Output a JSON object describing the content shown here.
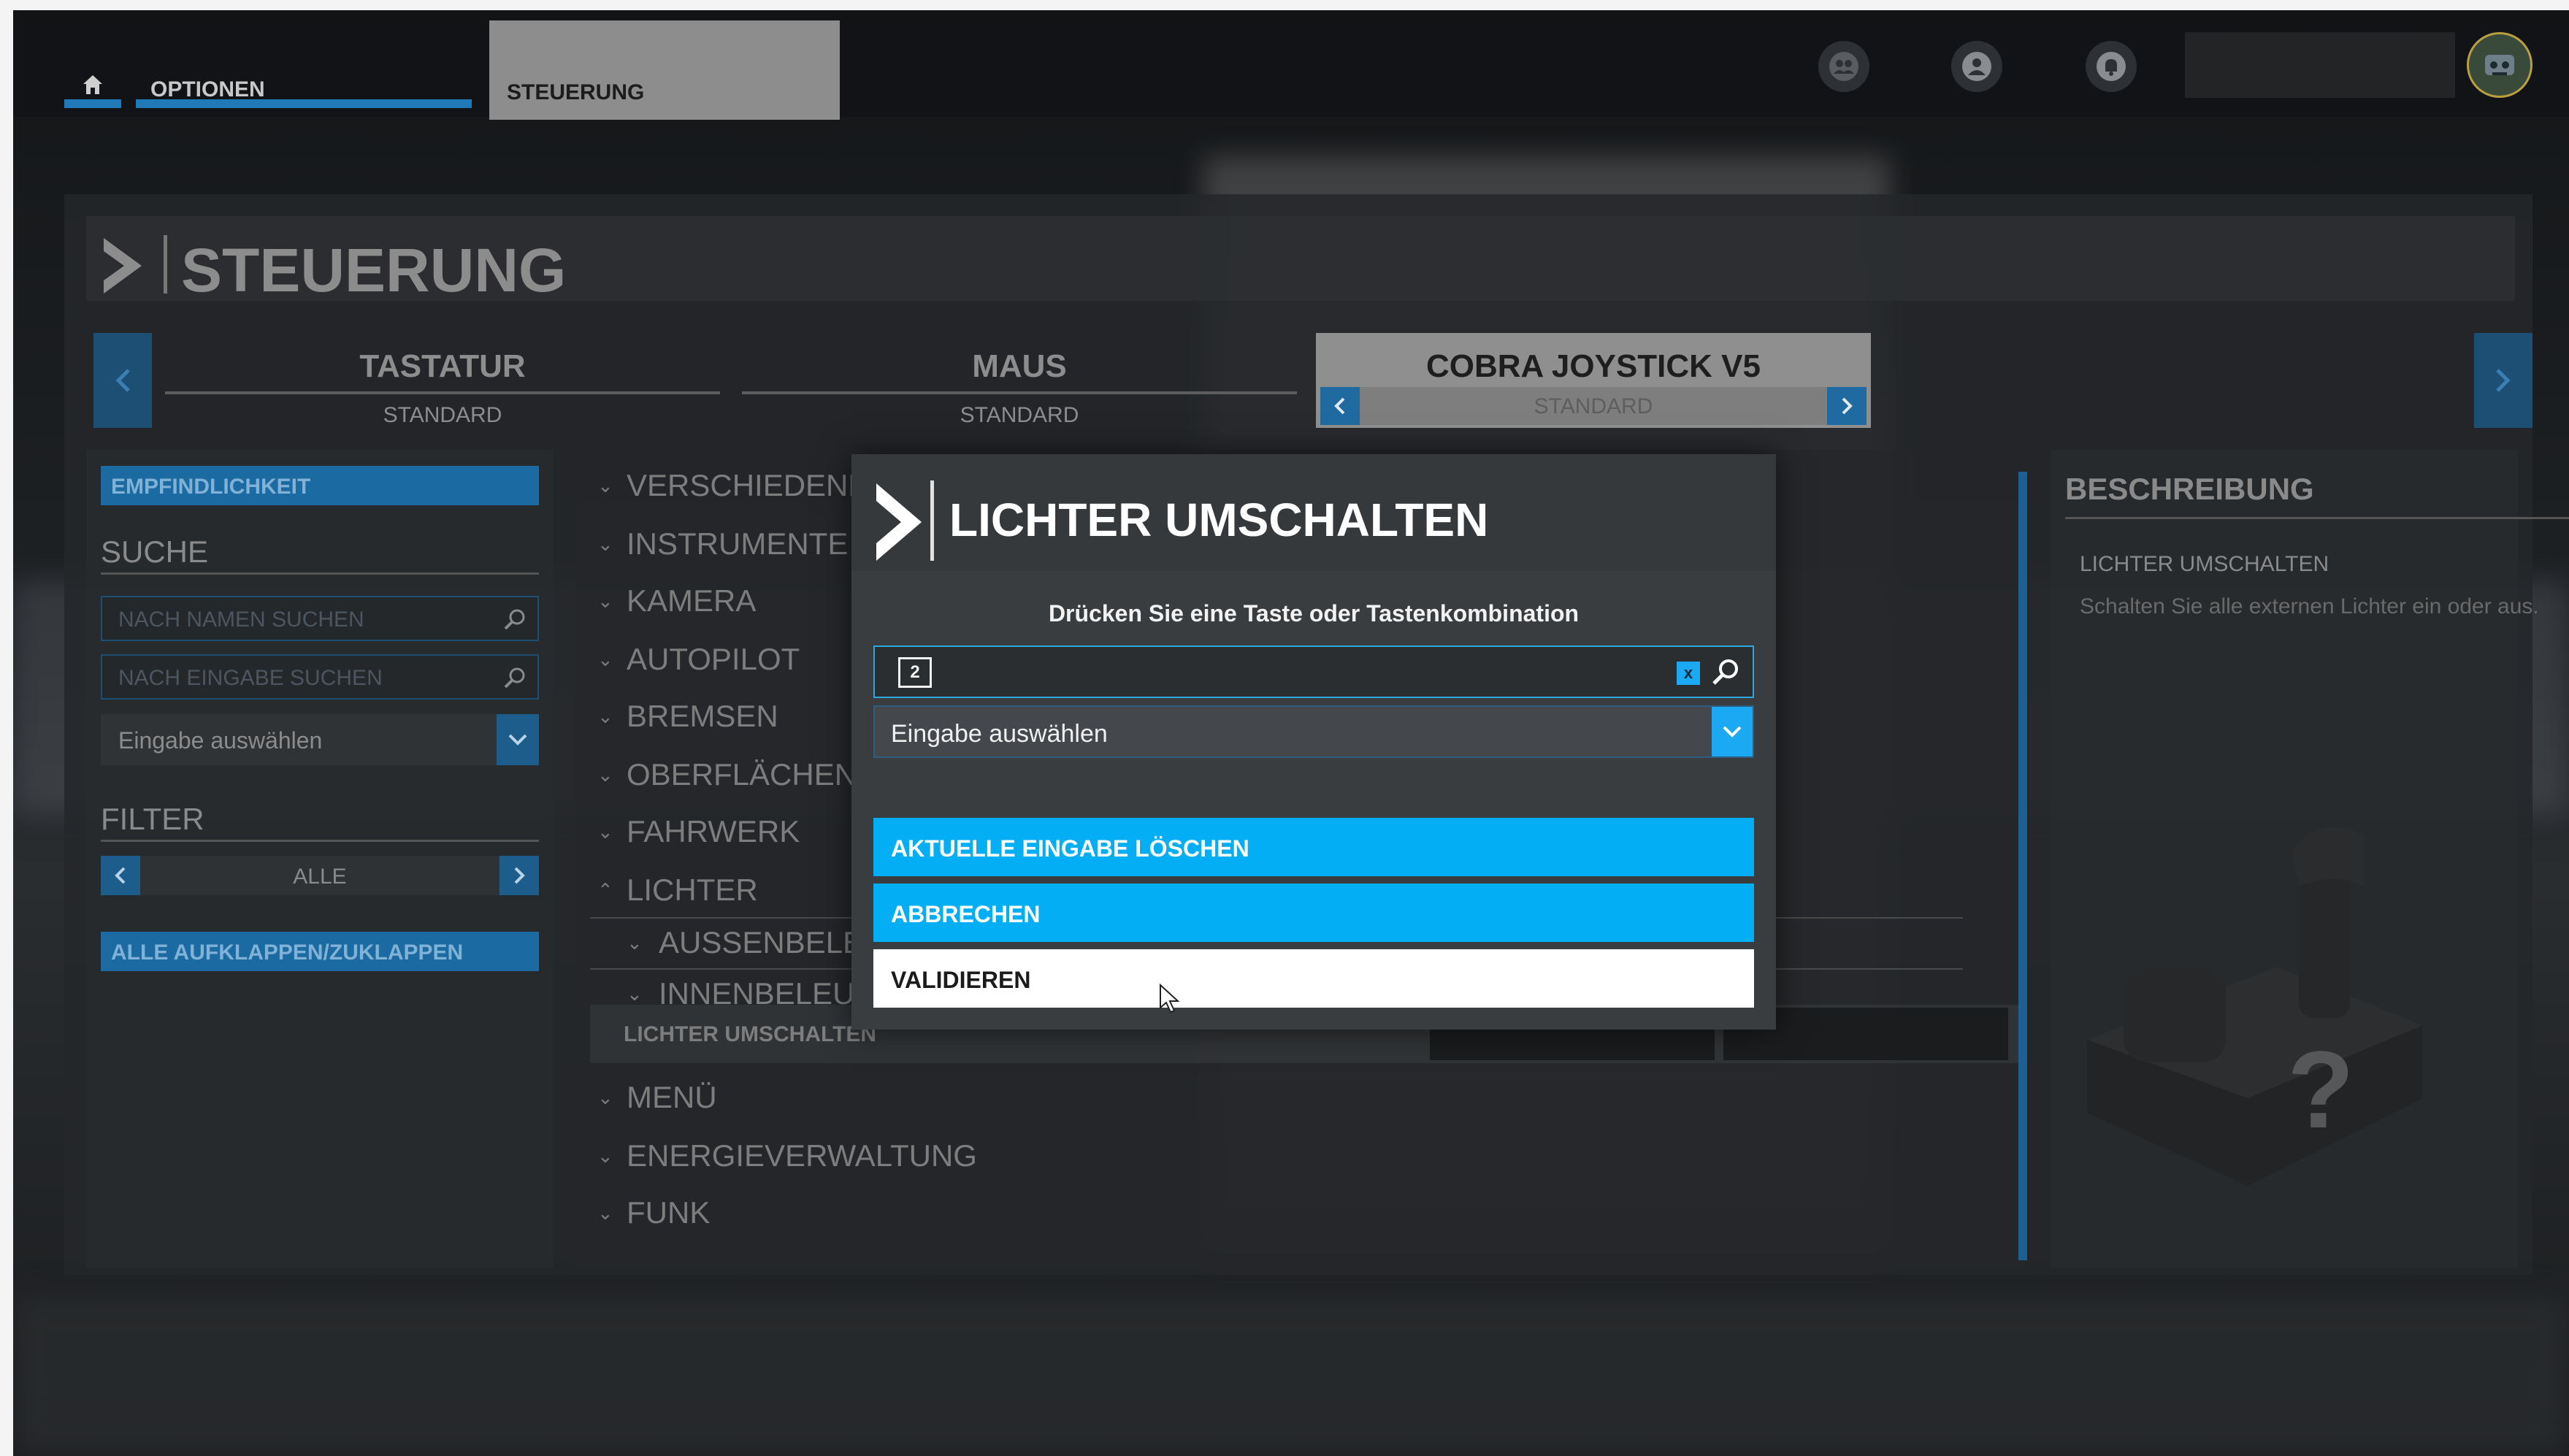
{
  "topbar": {
    "home_label": "",
    "options_tab": "OPTIONEN",
    "control_tab": "STEUERUNG",
    "icons": [
      "friends-icon",
      "profile-icon",
      "notifications-icon"
    ]
  },
  "page": {
    "title": "STEUERUNG"
  },
  "devices": [
    {
      "name": "TASTATUR",
      "profile": "STANDARD"
    },
    {
      "name": "MAUS",
      "profile": "STANDARD"
    },
    {
      "name": "COBRA JOYSTICK V5",
      "profile": "STANDARD"
    }
  ],
  "sidebar": {
    "sensitivity_button": "EMPFINDLICHKEIT",
    "search_heading": "SUCHE",
    "search_name_placeholder": "NACH NAMEN SUCHEN",
    "search_input_placeholder": "NACH EINGABE SUCHEN",
    "select_input": "Eingabe auswählen",
    "filter_heading": "FILTER",
    "filter_value": "ALLE",
    "expand_button": "ALLE AUFKLAPPEN/ZUKLAPPEN"
  },
  "categories": {
    "c0": "VERSCHIEDENE",
    "c1": "INSTRUMENTE",
    "c2": "KAMERA",
    "c3": "AUTOPILOT",
    "c4": "BREMSEN",
    "c5": "OBERFLÄCHEN",
    "c6": "FAHRWERK",
    "c7": "LICHTER",
    "sub0": "AUSSENBELE",
    "sub1": "INNENBELEU",
    "action": "LICHTER UMSCHALTEN",
    "c8": "MENÜ",
    "c9": "ENERGIEVERWALTUNG",
    "c10": "FUNK"
  },
  "description": {
    "heading": "BESCHREIBUNG",
    "title": "LICHTER UMSCHALTEN",
    "text": "Schalten Sie alle externen Lichter ein oder aus."
  },
  "modal": {
    "title": "LICHTER UMSCHALTEN",
    "prompt": "Drücken Sie eine Taste oder Tastenkombination",
    "key": "2",
    "clear_symbol": "x",
    "select_label": "Eingabe auswählen",
    "btn_clear": "AKTUELLE EINGABE LÖSCHEN",
    "btn_cancel": "ABBRECHEN",
    "btn_validate": "VALIDIEREN"
  },
  "colors": {
    "accent": "#03aef5",
    "accent_dim": "#1b6aa1"
  }
}
